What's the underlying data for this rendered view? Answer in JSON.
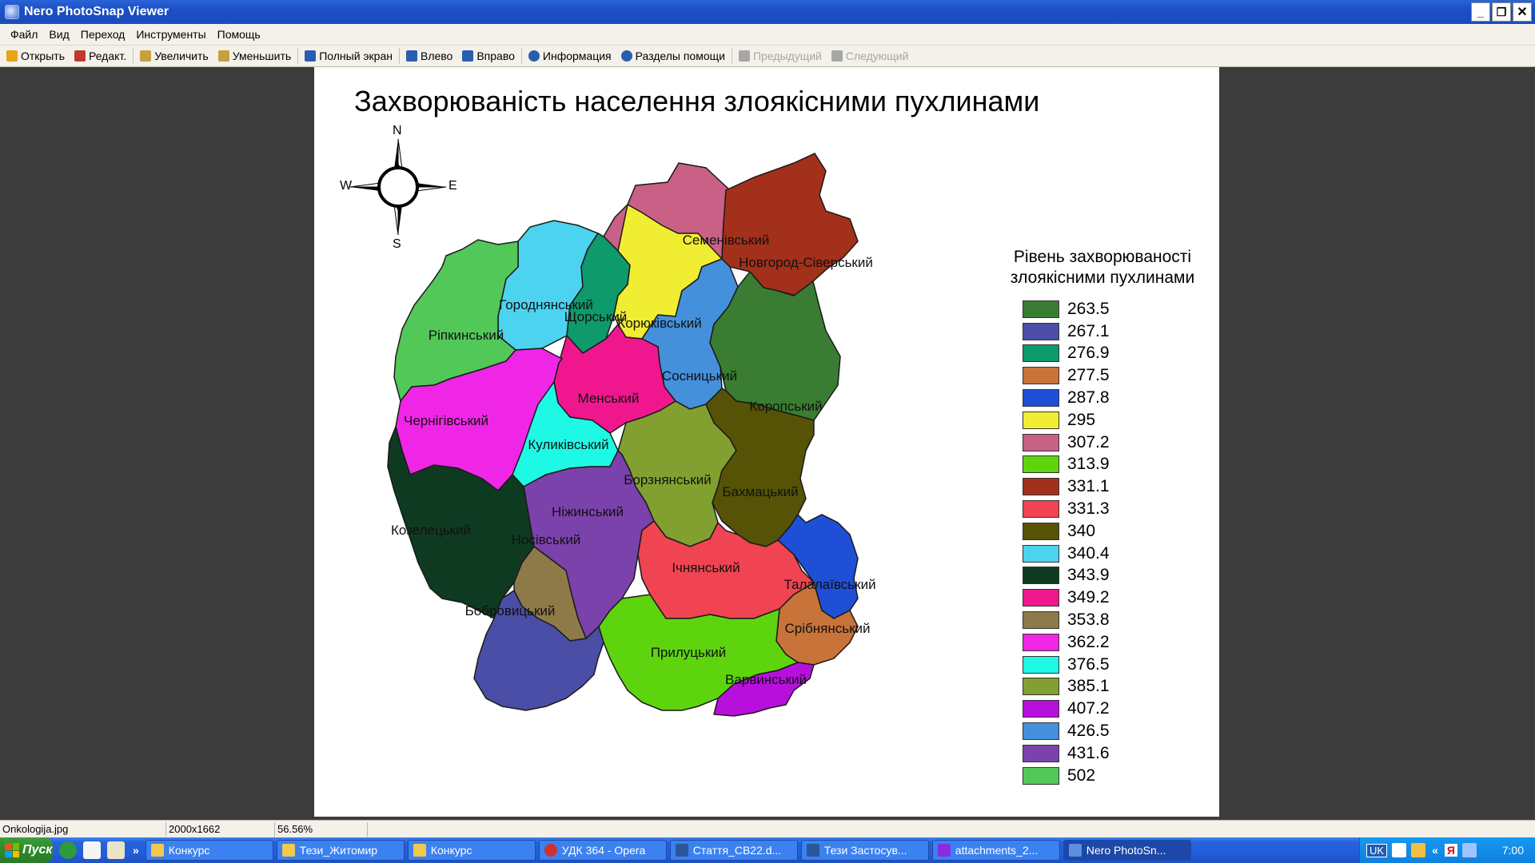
{
  "window": {
    "title": "Nero PhotoSnap Viewer",
    "minimize_glyph": "_",
    "restore_glyph": "❐",
    "close_glyph": "✕"
  },
  "menu": [
    "Файл",
    "Вид",
    "Переход",
    "Инструменты",
    "Помощь"
  ],
  "toolbar": [
    {
      "label": "Открыть",
      "icon": "open-folder-icon",
      "color": "#e8a317",
      "enabled": true
    },
    {
      "label": "Редакт.",
      "icon": "edit-icon",
      "color": "#c0392b",
      "enabled": true
    },
    {
      "label": "Увеличить",
      "icon": "zoom-in-icon",
      "color": "#c8a040",
      "enabled": true
    },
    {
      "label": "Уменьшить",
      "icon": "zoom-out-icon",
      "color": "#c8a040",
      "enabled": true
    },
    {
      "label": "Полный экран",
      "icon": "fullscreen-icon",
      "color": "#2a5db0",
      "enabled": true
    },
    {
      "label": "Влево",
      "icon": "rotate-left-icon",
      "color": "#2a5db0",
      "enabled": true
    },
    {
      "label": "Вправо",
      "icon": "rotate-right-icon",
      "color": "#2a5db0",
      "enabled": true
    },
    {
      "label": "Информация",
      "icon": "info-icon",
      "color": "#2a5db0",
      "enabled": true
    },
    {
      "label": "Разделы помощи",
      "icon": "help-icon",
      "color": "#2a5db0",
      "enabled": true
    },
    {
      "label": "Предыдущий",
      "icon": "arrow-left-icon",
      "color": "#a6a6a6",
      "enabled": false
    },
    {
      "label": "Следующий",
      "icon": "arrow-right-icon",
      "color": "#a6a6a6",
      "enabled": false
    }
  ],
  "image": {
    "title": "Захворюваність населення злоякісними пухлинами",
    "compass": {
      "n": "N",
      "s": "S",
      "e": "E",
      "w": "W"
    },
    "legend_title_line1": "Рівень захворюваності",
    "legend_title_line2": "злоякісними пухлинами",
    "legend": [
      {
        "value": "263.5",
        "color": "#3a7d32"
      },
      {
        "value": "267.1",
        "color": "#4b4ea6"
      },
      {
        "value": "276.9",
        "color": "#0e9a6a"
      },
      {
        "value": "277.5",
        "color": "#c8733a"
      },
      {
        "value": "287.8",
        "color": "#1f4fd6"
      },
      {
        "value": "295",
        "color": "#f0ed32"
      },
      {
        "value": "307.2",
        "color": "#c96086"
      },
      {
        "value": "313.9",
        "color": "#5ed40e"
      },
      {
        "value": "331.1",
        "color": "#a3301a"
      },
      {
        "value": "331.3",
        "color": "#f04452"
      },
      {
        "value": "340",
        "color": "#565307"
      },
      {
        "value": "340.4",
        "color": "#4bd3f0"
      },
      {
        "value": "343.9",
        "color": "#0f3a22"
      },
      {
        "value": "349.2",
        "color": "#f0178e"
      },
      {
        "value": "353.8",
        "color": "#8e7a49"
      },
      {
        "value": "362.2",
        "color": "#f026e6"
      },
      {
        "value": "376.5",
        "color": "#1ef9e6"
      },
      {
        "value": "385.1",
        "color": "#82a030"
      },
      {
        "value": "407.2",
        "color": "#b70fdc"
      },
      {
        "value": "426.5",
        "color": "#4590db"
      },
      {
        "value": "431.6",
        "color": "#7b42ab"
      },
      {
        "value": "502",
        "color": "#52c859"
      }
    ],
    "districts": [
      {
        "name": "Семенівський",
        "color": "#c96086"
      },
      {
        "name": "Новгород-Сіверський",
        "color": "#a3301a"
      },
      {
        "name": "Городнянський",
        "color": "#4bd3f0"
      },
      {
        "name": "Рiпкинський",
        "color": "#52c859"
      },
      {
        "name": "Щорський",
        "color": "#0e9a6a"
      },
      {
        "name": "Корюківський",
        "color": "#f0ed32"
      },
      {
        "name": "Сосницький",
        "color": "#4590db"
      },
      {
        "name": "Коропський",
        "color": "#3a7d32"
      },
      {
        "name": "Менський",
        "color": "#f0178e"
      },
      {
        "name": "Чернігівський",
        "color": "#f026e6"
      },
      {
        "name": "Куликівський",
        "color": "#1ef9e6"
      },
      {
        "name": "Борзнянський",
        "color": "#82a030"
      },
      {
        "name": "Бахмацький",
        "color": "#565307"
      },
      {
        "name": "Ніжинський",
        "color": "#7b42ab"
      },
      {
        "name": "Козелецький",
        "color": "#0f3a22"
      },
      {
        "name": "Носівський",
        "color": "#8e7a49"
      },
      {
        "name": "Ічнянський",
        "color": "#f04452"
      },
      {
        "name": "Талалаївський",
        "color": "#1f4fd6"
      },
      {
        "name": "Бобровицький",
        "color": "#4b4ea6"
      },
      {
        "name": "Срібнянський",
        "color": "#c8733a"
      },
      {
        "name": "Прилуцький",
        "color": "#5ed40e"
      },
      {
        "name": "Варвинський",
        "color": "#b70fdc"
      }
    ]
  },
  "status": {
    "filename": "Onkologija.jpg",
    "dimensions": "2000x1662",
    "zoom": "56.56%"
  },
  "taskbar": {
    "start_label": "Пуск",
    "overflow_glyph": "»",
    "tasks": [
      {
        "label": "Конкурс",
        "icon": "folder-icon",
        "color": "#f2c94c",
        "active": false
      },
      {
        "label": "Тези_Житомир",
        "icon": "folder-icon",
        "color": "#f2c94c",
        "active": false
      },
      {
        "label": "Конкурс",
        "icon": "folder-icon",
        "color": "#f2c94c",
        "active": false
      },
      {
        "label": "УДК 364 - Opera",
        "icon": "opera-icon",
        "color": "#d0312d",
        "active": false
      },
      {
        "label": "Стаття_СВ22.d...",
        "icon": "word-doc-icon",
        "color": "#2b579a",
        "active": false
      },
      {
        "label": "Тези Застосув...",
        "icon": "word-doc-icon",
        "color": "#2b579a",
        "active": false
      },
      {
        "label": "attachments_2...",
        "icon": "archive-icon",
        "color": "#8a2be2",
        "active": false
      },
      {
        "label": "Nero PhotoSn...",
        "icon": "photosnap-icon",
        "color": "#5c8fe0",
        "active": true
      }
    ],
    "tray": {
      "language": "UK",
      "clock": "7:00",
      "expand_glyph": "«",
      "yandex_glyph": "Я"
    }
  }
}
